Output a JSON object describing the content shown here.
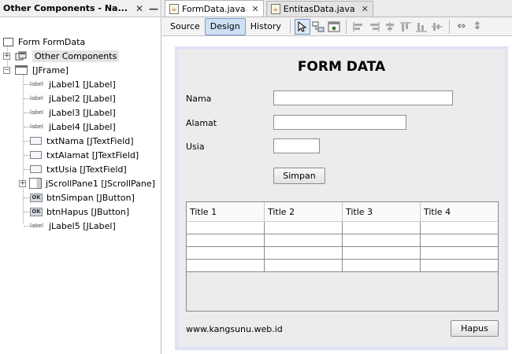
{
  "navigator": {
    "title": "Other Components - Na...",
    "close": "✕",
    "minimize": "—",
    "root": "Form FormData",
    "other_components": "Other Components",
    "frame": "[JFrame]",
    "items": [
      "jLabel1 [JLabel]",
      "jLabel2 [JLabel]",
      "jLabel3 [JLabel]",
      "jLabel4 [JLabel]",
      "txtNama [JTextField]",
      "txtAlamat [JTextField]",
      "txtUsia [JTextField]",
      "jScrollPane1 [JScrollPane]",
      "btnSimpan [JButton]",
      "btnHapus [JButton]",
      "jLabel5 [JLabel]"
    ],
    "label_icon_text": "label",
    "button_icon_text": "OK"
  },
  "tabs": [
    {
      "label": "FormData.java",
      "active": true
    },
    {
      "label": "EntitasData.java",
      "active": false
    }
  ],
  "tab_close": "✕",
  "toolbar": {
    "source": "Source",
    "design": "Design",
    "history": "History"
  },
  "form": {
    "title": "FORM DATA",
    "label_nama": "Nama",
    "label_alamat": "Alamat",
    "label_usia": "Usia",
    "btn_simpan": "Simpan",
    "btn_hapus": "Hapus",
    "footer": "www.kangsunu.web.id",
    "table_headers": [
      "Title 1",
      "Title 2",
      "Title 3",
      "Title 4"
    ]
  },
  "colors": {
    "selection": "#cfe0f5",
    "frame_border": "#dfe3f3"
  }
}
